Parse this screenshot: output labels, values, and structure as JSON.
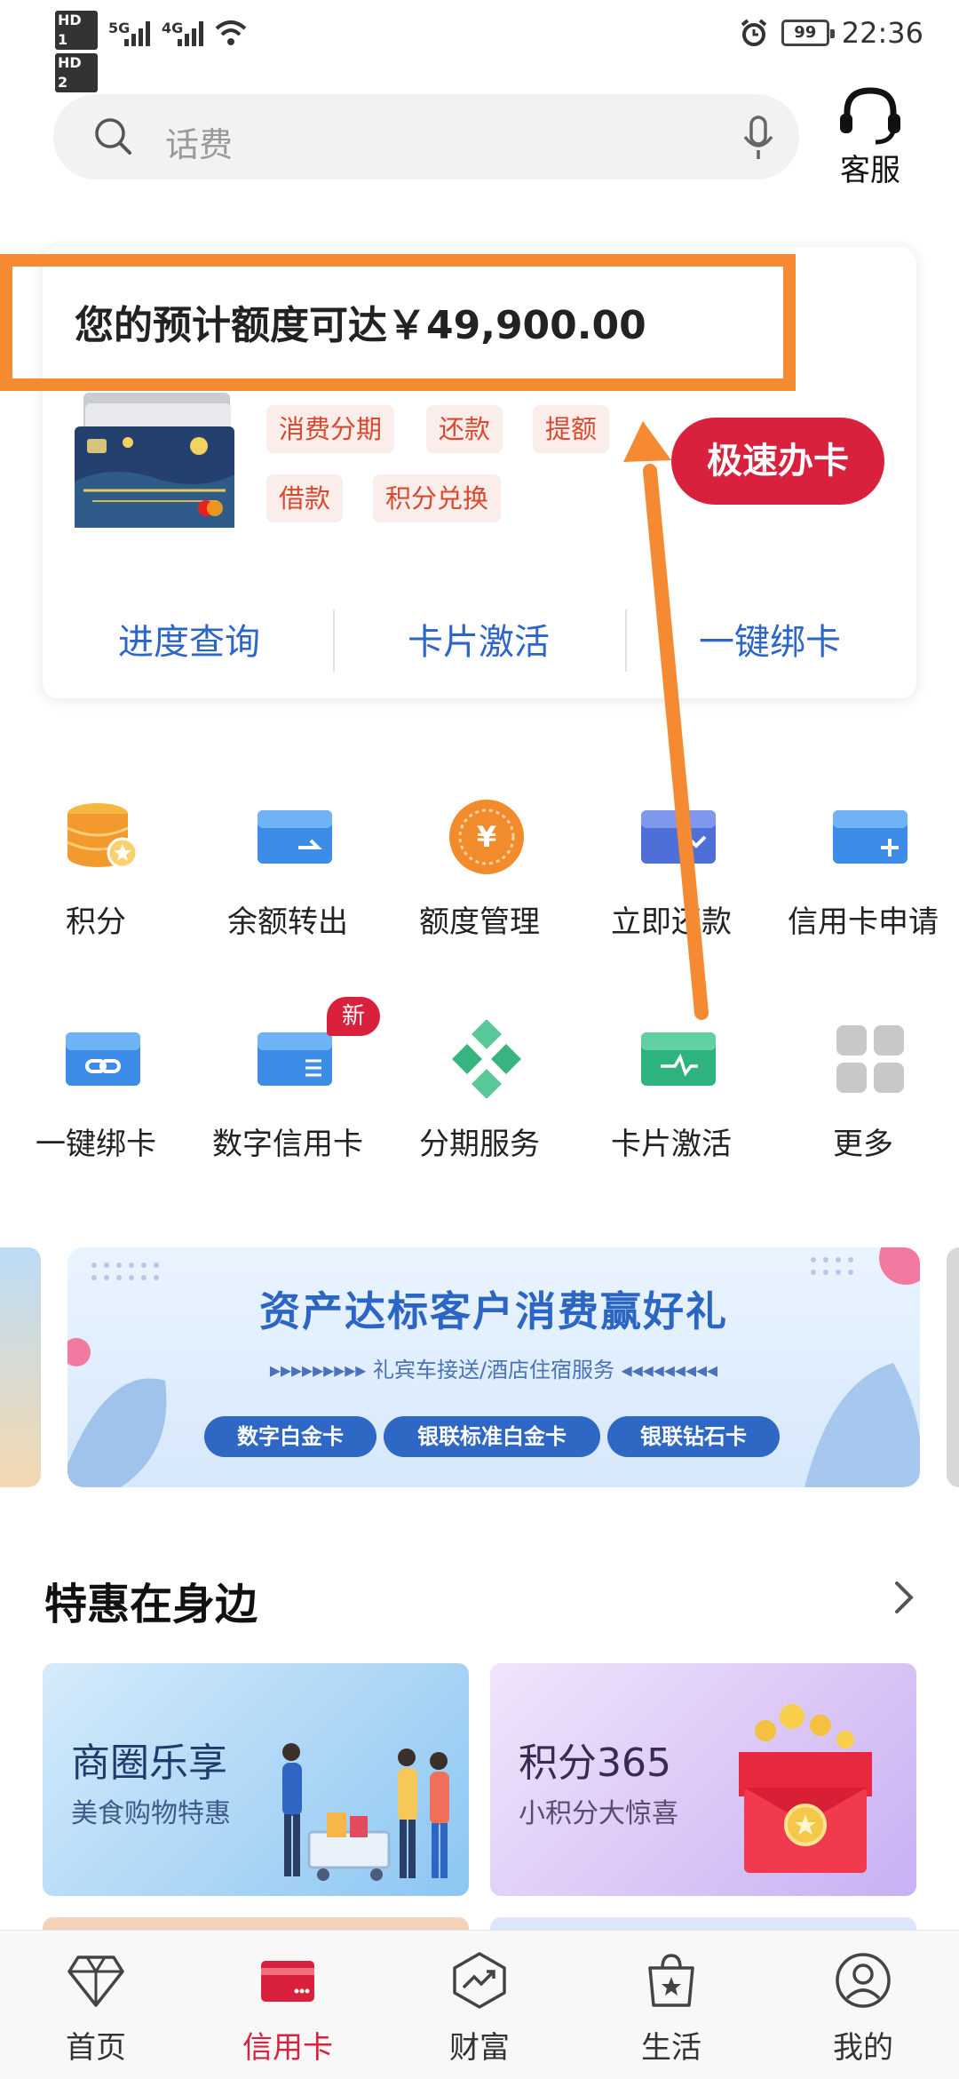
{
  "status_bar": {
    "hd1": "HD 1",
    "hd2": "HD 2",
    "net1": "5G",
    "net2": "4G",
    "battery": "99",
    "time": "22:36"
  },
  "header": {
    "search_placeholder": "话费",
    "customer_service": "客服"
  },
  "credit_panel": {
    "limit_text": "您的预计额度可达￥49,900.00",
    "chips": [
      "消费分期",
      "还款",
      "提额",
      "借款",
      "积分兑换"
    ],
    "apply_button": "极速办卡",
    "links": [
      "进度查询",
      "卡片激活",
      "一键绑卡"
    ]
  },
  "grid": {
    "row1": [
      "积分",
      "余额转出",
      "额度管理",
      "立即还款",
      "信用卡申请"
    ],
    "row2": [
      "一键绑卡",
      "数字信用卡",
      "分期服务",
      "卡片激活",
      "更多"
    ],
    "new_badge": "新"
  },
  "banner": {
    "title": "资产达标客户消费赢好礼",
    "subtitle": "▸▸▸▸▸▸▸▸▸ 礼宾车接送/酒店住宿服务 ◂◂◂◂◂◂◂◂◂",
    "pills": [
      "数字白金卡",
      "银联标准白金卡",
      "银联钻石卡"
    ]
  },
  "promo": {
    "section_title": "特惠在身边",
    "items": [
      {
        "title": "商圈乐享",
        "subtitle": "美食购物特惠"
      },
      {
        "title": "积分365",
        "subtitle": "小积分大惊喜"
      }
    ]
  },
  "bottom_nav": {
    "items": [
      "首页",
      "信用卡",
      "财富",
      "生活",
      "我的"
    ],
    "active": "信用卡"
  },
  "colors": {
    "accent_red": "#d9213e",
    "link_blue": "#2d66c6",
    "annotation_orange": "#f58a33"
  }
}
